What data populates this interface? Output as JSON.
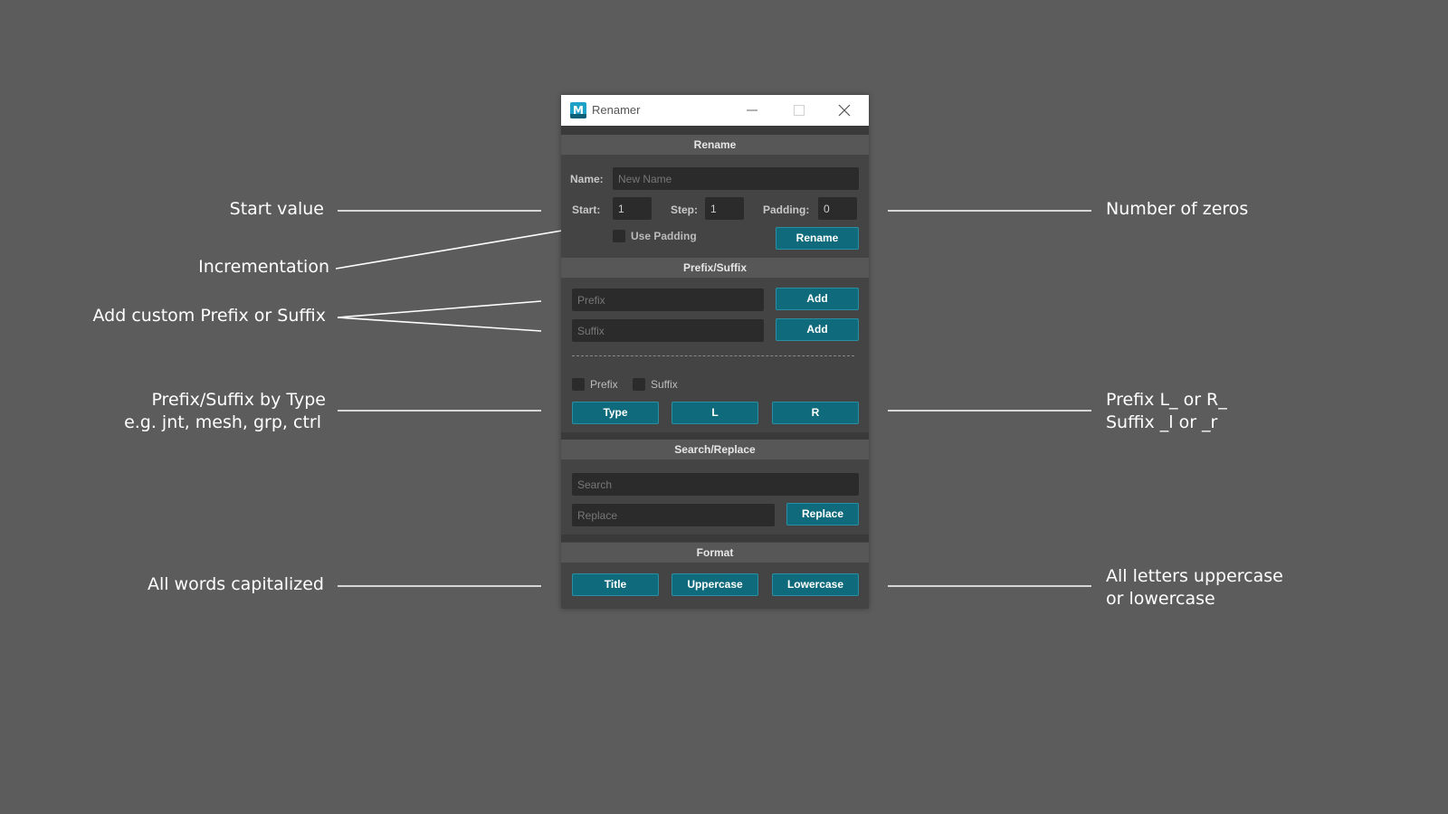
{
  "window": {
    "title": "Renamer",
    "icon_letter": "M",
    "controls": [
      "minimize-icon",
      "maximize-icon",
      "close-icon"
    ]
  },
  "rename": {
    "header": "Rename",
    "name_label": "Name:",
    "name_placeholder": "New Name",
    "start_label": "Start:",
    "start_value": "1",
    "step_label": "Step:",
    "step_value": "1",
    "padding_label": "Padding:",
    "padding_value": "0",
    "use_padding_label": "Use Padding",
    "use_padding_checked": false,
    "rename_button": "Rename"
  },
  "prefix_suffix": {
    "header": "Prefix/Suffix",
    "prefix_placeholder": "Prefix",
    "suffix_placeholder": "Suffix",
    "add_prefix_button": "Add",
    "add_suffix_button": "Add",
    "prefix_check_label": "Prefix",
    "suffix_check_label": "Suffix",
    "type_button": "Type",
    "l_button": "L",
    "r_button": "R"
  },
  "search_replace": {
    "header": "Search/Replace",
    "search_placeholder": "Search",
    "replace_placeholder": "Replace",
    "replace_button": "Replace"
  },
  "format": {
    "header": "Format",
    "title_button": "Title",
    "uppercase_button": "Uppercase",
    "lowercase_button": "Lowercase"
  },
  "annotations": {
    "start_value": "Start value",
    "incrementation": "Incrementation",
    "custom_prefix_suffix": "Add custom Prefix or Suffix",
    "by_type_line1": "Prefix/Suffix by Type",
    "by_type_line2": "e.g. jnt, mesh, grp, ctrl",
    "all_words": "All words capitalized",
    "number_of_zeros": "Number of zeros",
    "prefix_lr_line1": "Prefix L_ or R_",
    "prefix_lr_line2": "Suffix _l or _r",
    "case_line1": "All letters uppercase",
    "case_line2": "or lowercase"
  },
  "colors": {
    "background": "#5c5c5c",
    "panel": "#444444",
    "accent_button": "#0f6a7c",
    "field": "#2b2b2b"
  }
}
